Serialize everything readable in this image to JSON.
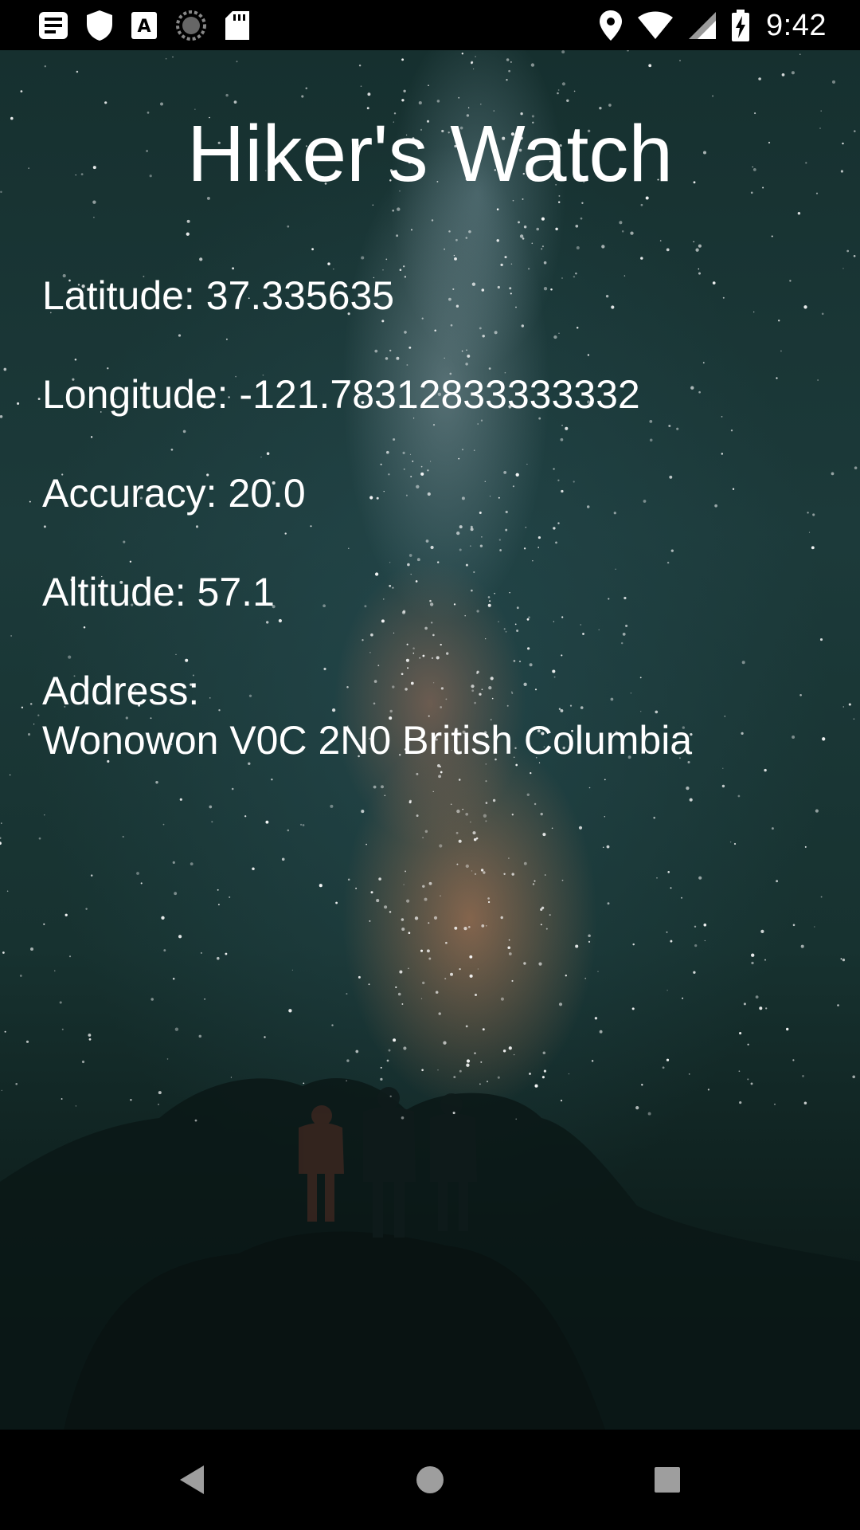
{
  "status_bar": {
    "time": "9:42",
    "left_icons": [
      "notes-icon",
      "shield-icon",
      "font-a-icon",
      "sync-circle-icon",
      "sd-card-icon"
    ],
    "right_icons": [
      "location-pin-icon",
      "wifi-icon",
      "cell-signal-icon",
      "battery-charging-icon"
    ]
  },
  "app": {
    "title": "Hiker's Watch",
    "latitude": "Latitude: 37.335635",
    "longitude": "Longitude: -121.78312833333332",
    "accuracy": "Accuracy: 20.0",
    "altitude": "Altitude: 57.1",
    "address_label": "Address:",
    "address_value": "Wonowon V0C 2N0 British Columbia"
  },
  "nav_bar": {
    "buttons": [
      "back-icon",
      "home-icon",
      "recents-icon"
    ]
  },
  "colors": {
    "status_bar_bg": "#000000",
    "text": "#ffffff",
    "sky_dark": "#16302f",
    "milky_way_glow": "#d8865a"
  }
}
